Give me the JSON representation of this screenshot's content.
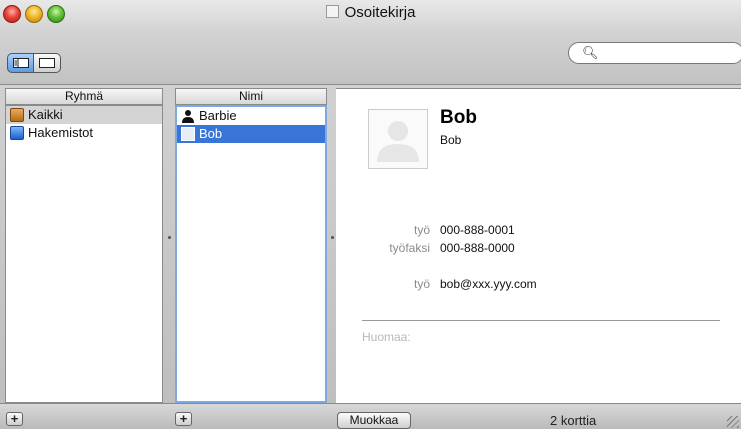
{
  "window": {
    "title": "Osoitekirja"
  },
  "toolbar": {
    "search": {
      "placeholder": "",
      "value": ""
    }
  },
  "groups": {
    "header": "Ryhmä",
    "items": [
      {
        "label": "Kaikki",
        "icon": "address-book-icon",
        "selected": true
      },
      {
        "label": "Hakemistot",
        "icon": "directory-icon",
        "selected": false
      }
    ]
  },
  "names": {
    "header": "Nimi",
    "items": [
      {
        "label": "Barbie",
        "icon": "person-icon",
        "selected": false
      },
      {
        "label": "Bob",
        "icon": "card-icon",
        "selected": true
      }
    ]
  },
  "card": {
    "name": "Bob",
    "subname": "Bob",
    "fields": [
      {
        "label": "työ",
        "value": "000-888-0001"
      },
      {
        "label": "työfaksi",
        "value": "000-888-0000"
      },
      {
        "label": "työ",
        "value": "bob@xxx.yyy.com"
      }
    ],
    "note_label": "Huomaa:"
  },
  "footer": {
    "add_symbol": "+",
    "edit_label": "Muokkaa",
    "count": "2 korttia"
  },
  "colors": {
    "selection": "#3875d7",
    "selection_inactive": "#d4d4d4"
  }
}
